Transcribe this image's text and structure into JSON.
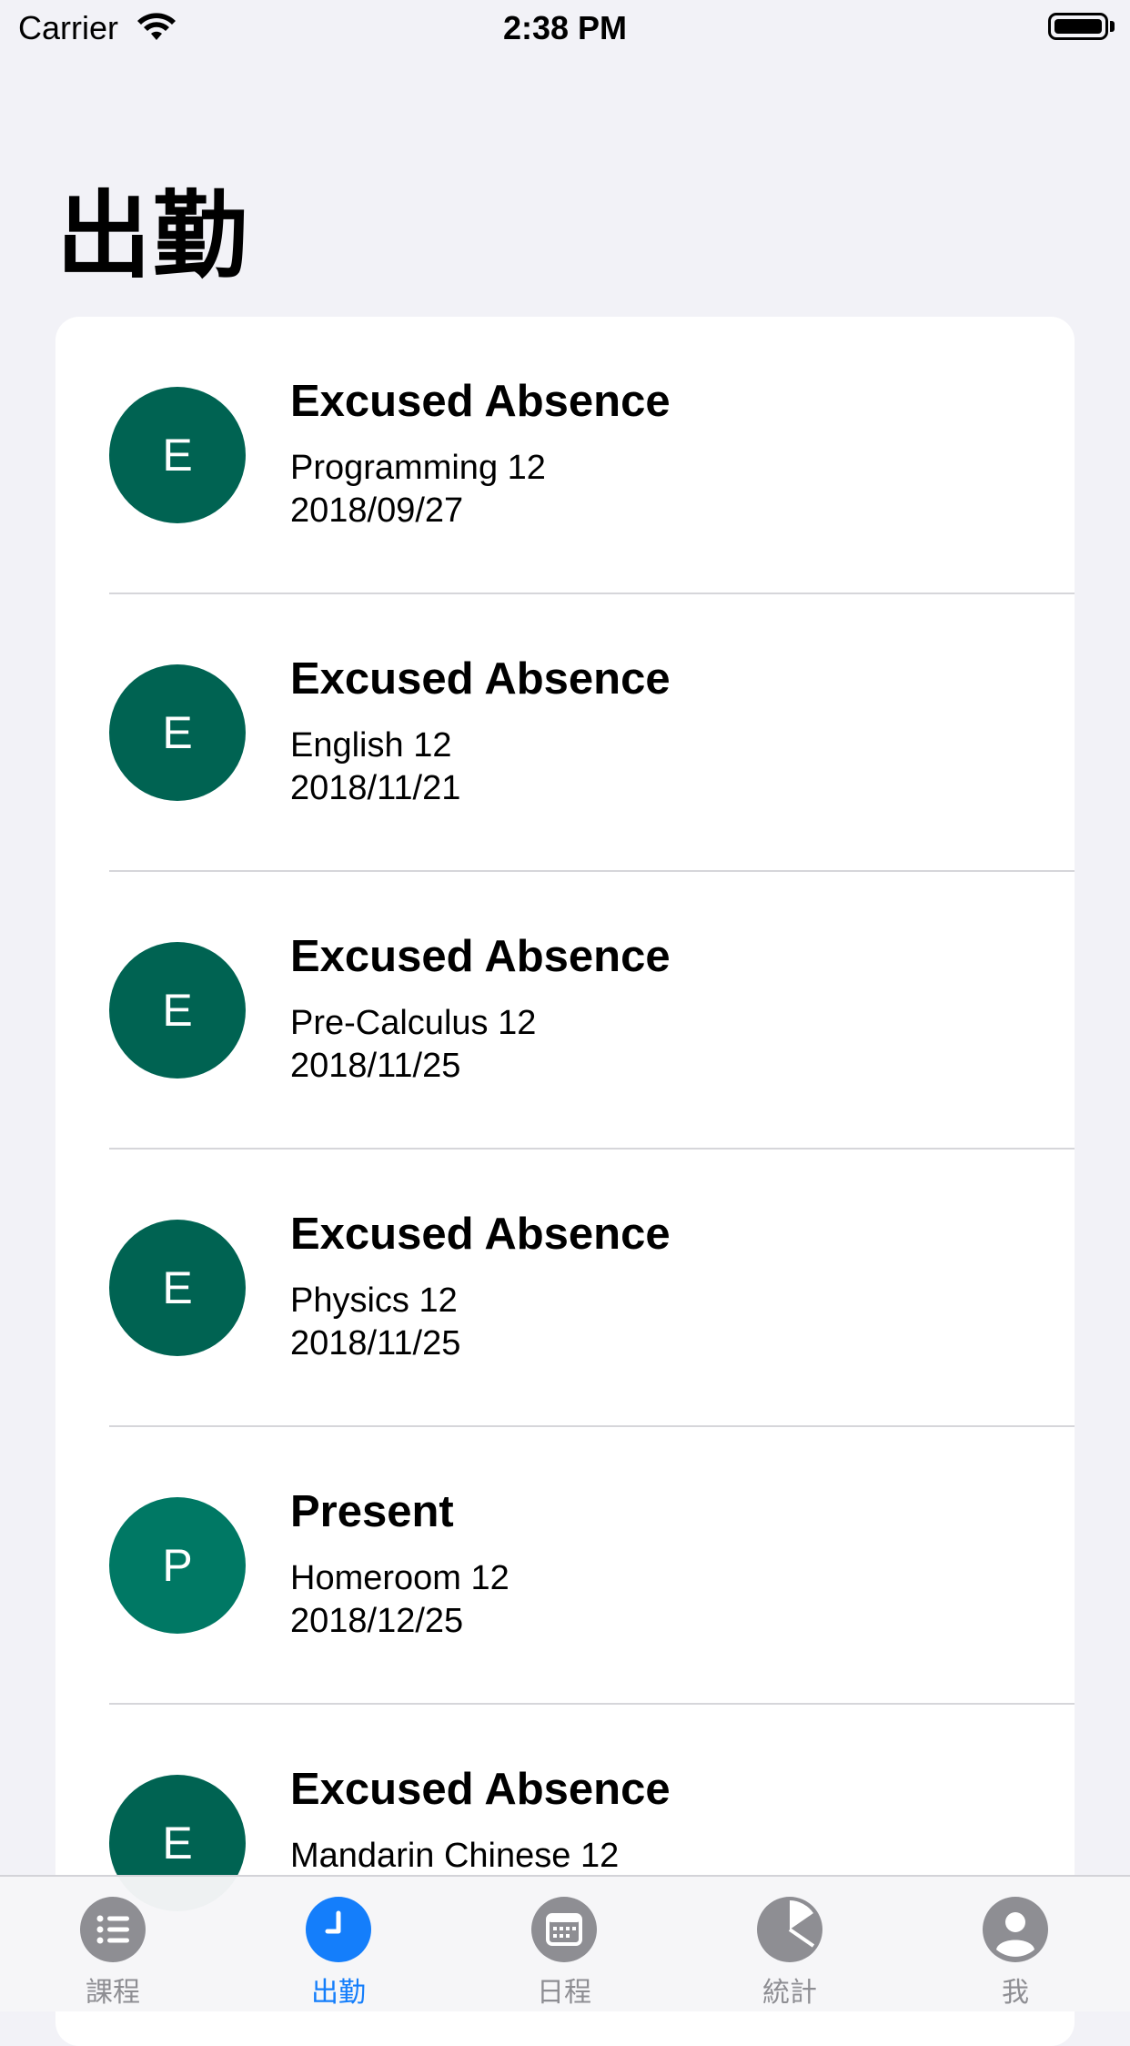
{
  "status_bar": {
    "carrier": "Carrier",
    "time": "2:38 PM"
  },
  "header": {
    "title": "出勤"
  },
  "records": [
    {
      "initial": "E",
      "status": "Excused Absence",
      "course": "Programming 12",
      "date": "2018/09/27",
      "color": "#006352"
    },
    {
      "initial": "E",
      "status": "Excused Absence",
      "course": "English 12",
      "date": "2018/11/21",
      "color": "#006352"
    },
    {
      "initial": "E",
      "status": "Excused Absence",
      "course": "Pre-Calculus 12",
      "date": "2018/11/25",
      "color": "#006352"
    },
    {
      "initial": "E",
      "status": "Excused Absence",
      "course": "Physics 12",
      "date": "2018/11/25",
      "color": "#006352"
    },
    {
      "initial": "P",
      "status": "Present",
      "course": "Homeroom 12",
      "date": "2018/12/25",
      "color": "#007864"
    },
    {
      "initial": "E",
      "status": "Excused Absence",
      "course": "Mandarin Chinese 12",
      "date": "",
      "color": "#006352"
    }
  ],
  "tab_bar": {
    "active_color": "#147efb",
    "inactive_color": "#8e8e93",
    "tabs": [
      {
        "label": "課程",
        "icon": "list-icon",
        "active": false
      },
      {
        "label": "出勤",
        "icon": "clock-icon",
        "active": true
      },
      {
        "label": "日程",
        "icon": "calendar-icon",
        "active": false
      },
      {
        "label": "統計",
        "icon": "pie-chart-icon",
        "active": false
      },
      {
        "label": "我",
        "icon": "person-icon",
        "active": false
      }
    ]
  }
}
